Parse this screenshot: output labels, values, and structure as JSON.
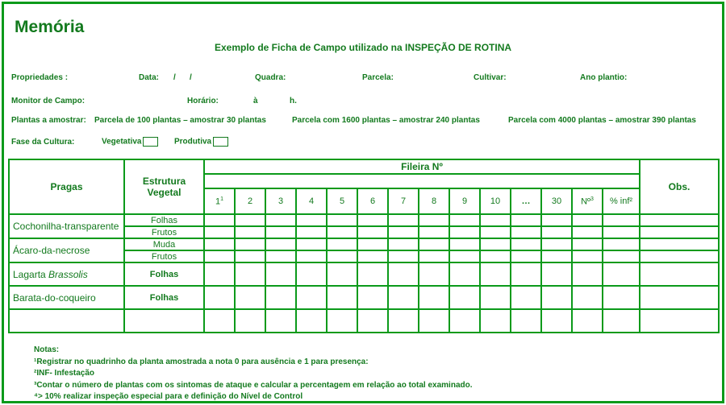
{
  "title": "Memória",
  "subtitle": "Exemplo de Ficha de Campo utilizado na INSPEÇÃO DE ROTINA",
  "fields": {
    "propriedades": "Propriedades :",
    "data": "Data:",
    "data_sep1": "/",
    "data_sep2": "/",
    "quadra": "Quadra:",
    "parcela": "Parcela:",
    "cultivar": "Cultivar:",
    "ano_plantio": "Ano plantio:",
    "monitor": "Monitor de Campo:",
    "horario": "Horário:",
    "horario_a": "à",
    "horario_h": "h.",
    "plantas_amostrar": "Plantas a amostrar:",
    "sample1": "Parcela de 100 plantas – amostrar 30 plantas",
    "sample2": "Parcela  com 1600 plantas – amostrar 240 plantas",
    "sample3": "Parcela com 4000 plantas – amostrar 390 plantas",
    "fase": "Fase da Cultura:",
    "vegetativa": "Vegetativa",
    "produtiva": "Produtiva"
  },
  "table": {
    "pragas_header": "Pragas",
    "estrutura_header_1": "Estrutura",
    "estrutura_header_2": "Vegetal",
    "fileira_header": "Fileira Nº",
    "obs_header": "Obs.",
    "columns": [
      "1",
      "2",
      "3",
      "4",
      "5",
      "6",
      "7",
      "8",
      "9",
      "10",
      "…",
      "30",
      "Nº",
      "% inf²"
    ],
    "col1_sup": "1",
    "colN_sup": "3",
    "pests": [
      {
        "name": "Cochonilha-transparente",
        "parts": [
          "Folhas",
          "Frutos"
        ]
      },
      {
        "name": "Ácaro-da-necrose",
        "parts": [
          "Muda",
          "Frutos"
        ]
      },
      {
        "name_plain": "Lagarta ",
        "name_italic": "Brassolis",
        "parts": [
          "Folhas"
        ]
      },
      {
        "name": "Barata-do-coqueiro",
        "parts": [
          "Folhas"
        ]
      }
    ]
  },
  "notes": {
    "heading": "Notas:",
    "n1": "¹Registrar no quadrinho da planta amostrada a nota 0 para ausência e 1 para presença:",
    "n2": "²INF- Infestação",
    "n3": "³Contar o número de plantas com os sintomas de ataque e calcular a percentagem em relação ao total examinado.",
    "n4": "⁴> 10% realizar inspeção especial para e definição do Nível de Control"
  },
  "colors": {
    "accent": "#0b9a1a",
    "text": "#137a1e"
  }
}
